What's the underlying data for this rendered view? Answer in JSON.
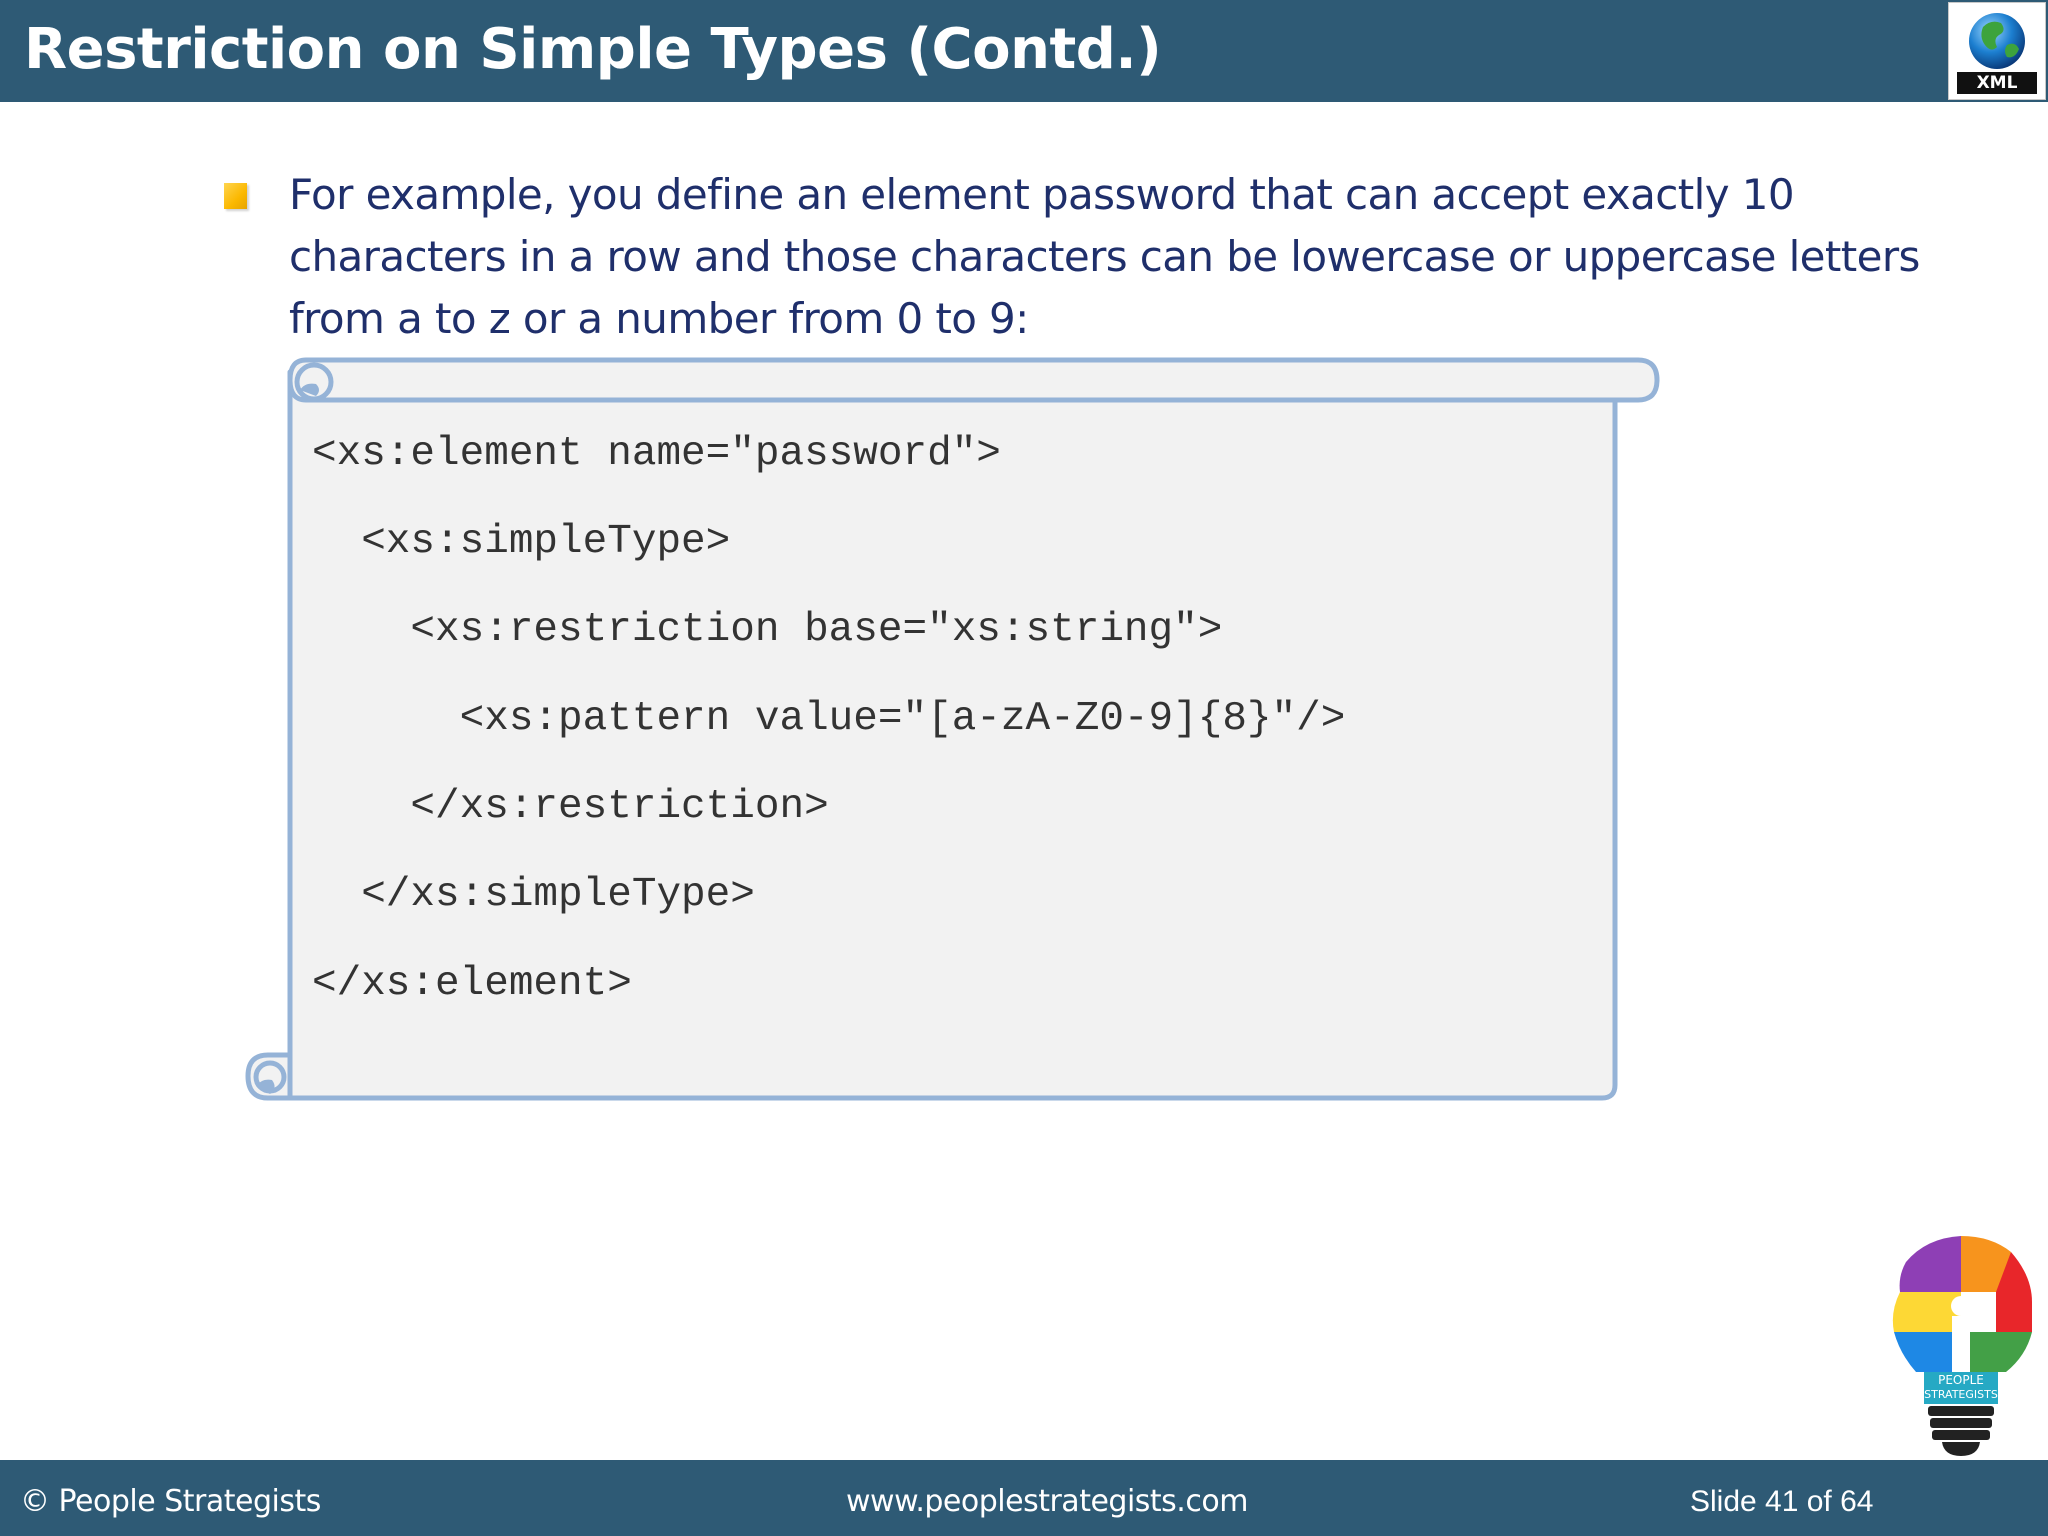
{
  "header": {
    "title": "Restriction on Simple Types (Contd.)",
    "logo_label": "XML"
  },
  "content": {
    "bullet_lines": [
      "For example, you define an element password that can accept exactly 10",
      "characters in a row and those characters can be lowercase or uppercase letters",
      "from a to z or a number from 0 to 9:"
    ],
    "code_lines": [
      "<xs:element name=\"password\">",
      "  <xs:simpleType>",
      "    <xs:restriction base=\"xs:string\">",
      "      <xs:pattern value=\"[a-zA-Z0-9]{8}\"/>",
      "    </xs:restriction>",
      "  </xs:simpleType>",
      "</xs:element>"
    ]
  },
  "footer": {
    "copyright": "© People Strategists",
    "website": "www.peoplestrategists.com",
    "slide_number": "Slide 41 of 64"
  },
  "brand_logo": {
    "text_line1": "PEOPLE",
    "text_line2": "STRATEGISTS"
  },
  "colors": {
    "header_bg": "#2e5a75",
    "bullet": "#fbb800",
    "body_text": "#1f2f6b",
    "scroll_fill": "#f2f2f2",
    "scroll_border": "#95b3d7"
  }
}
